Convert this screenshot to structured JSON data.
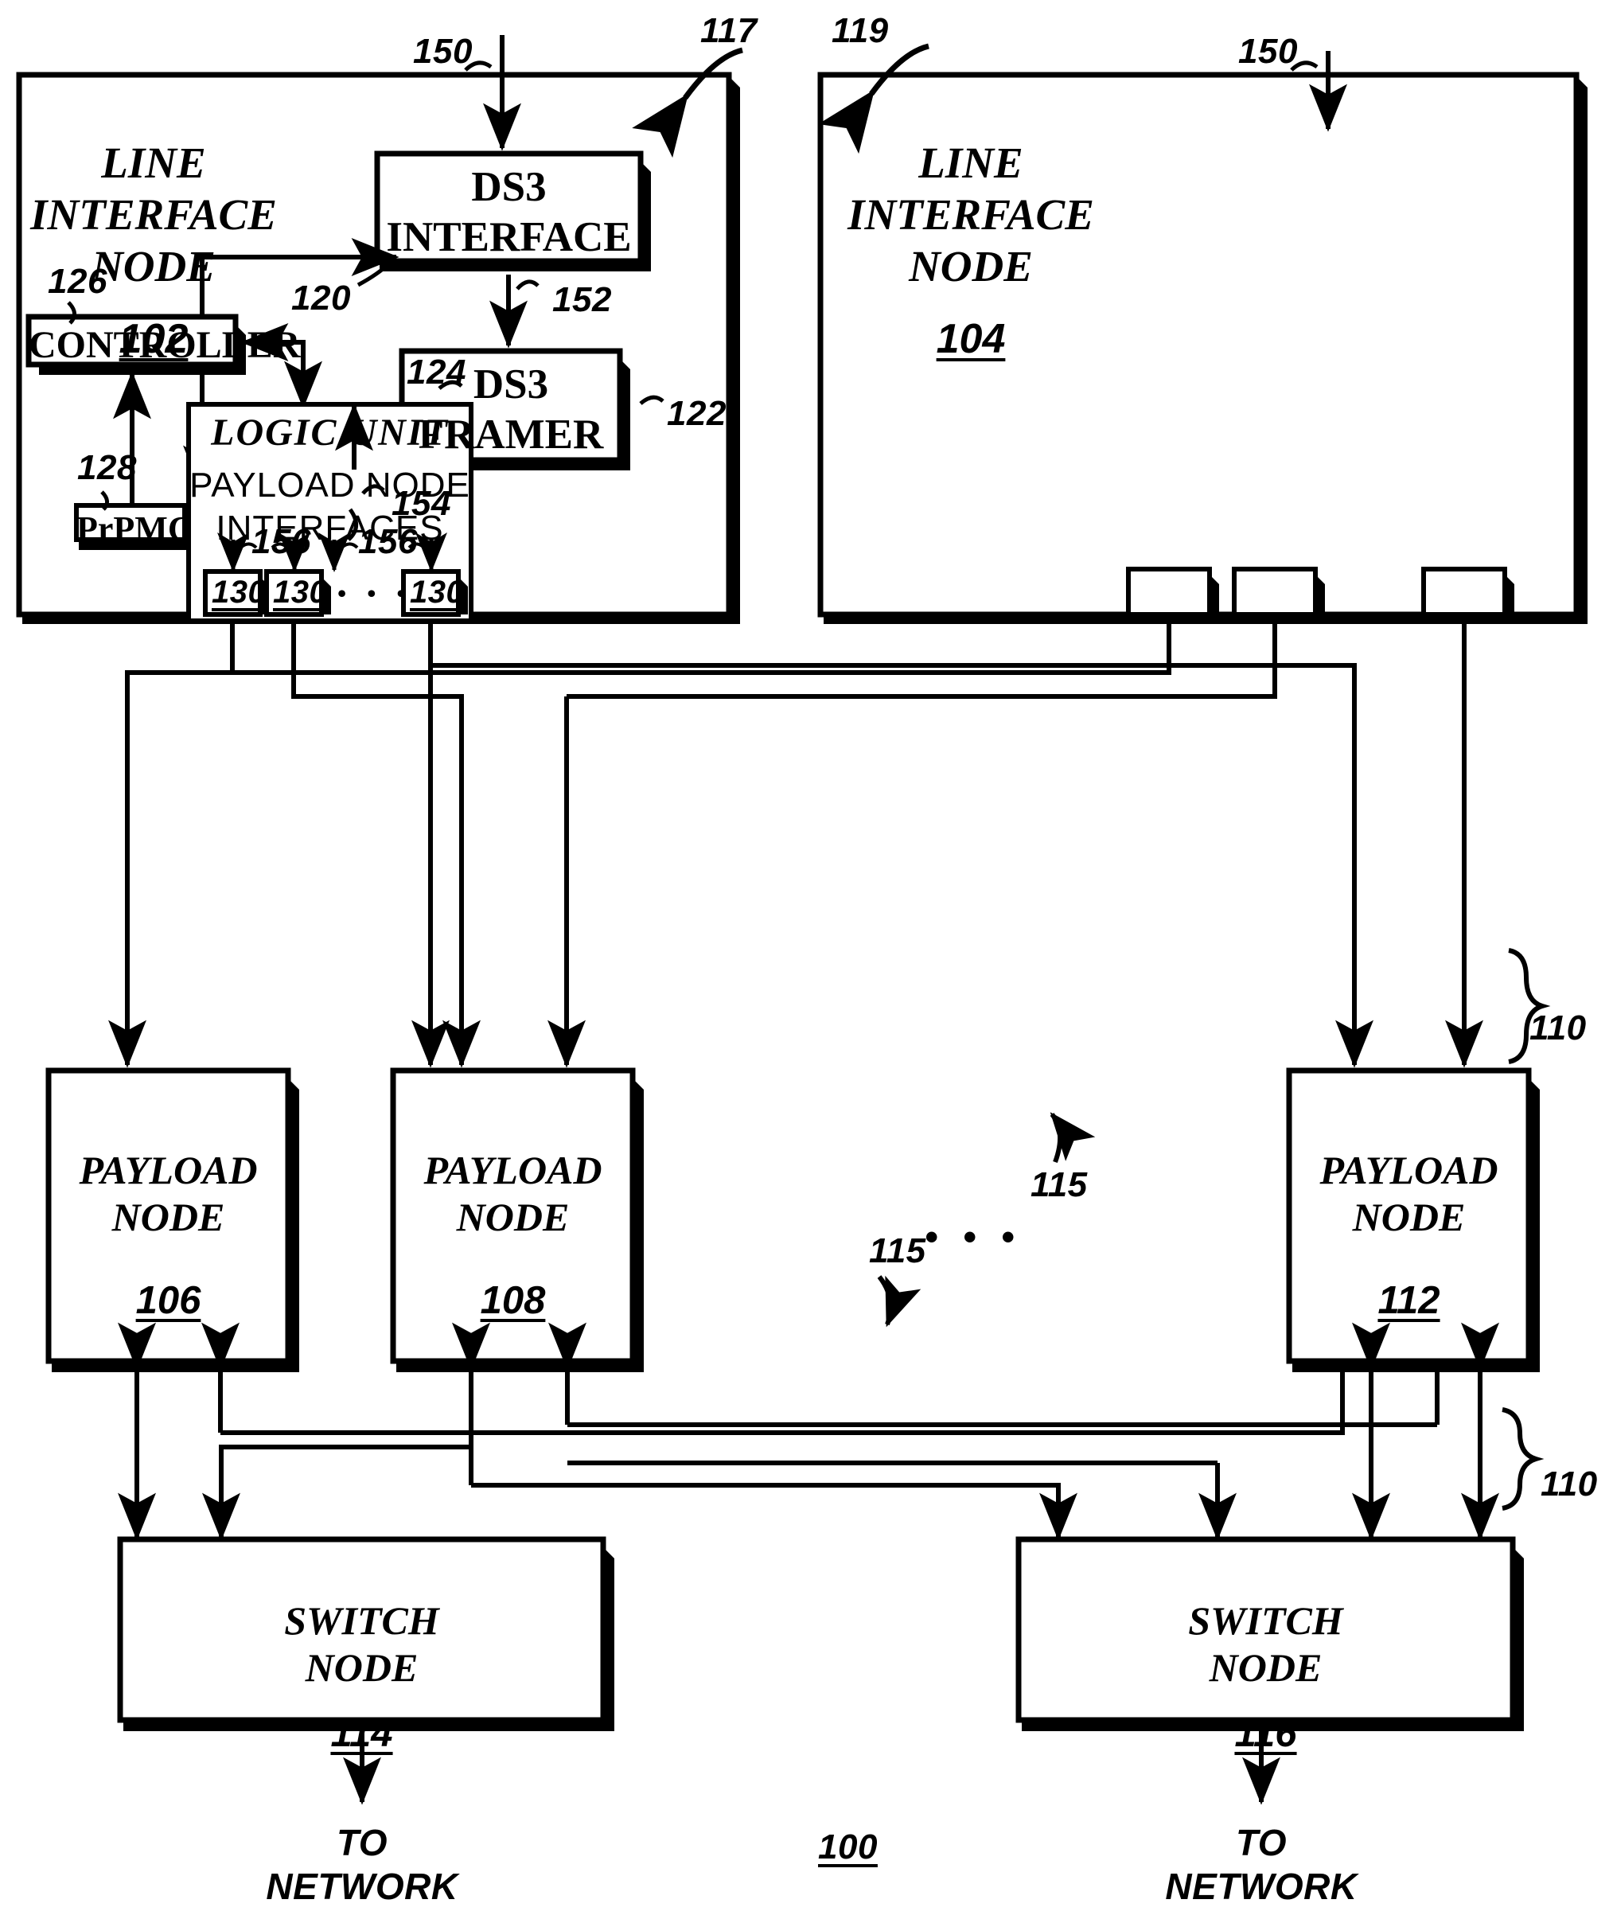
{
  "figure": {
    "number": "100",
    "title_refs": {
      "lin_group_117": "117",
      "lin_group_119": "119"
    }
  },
  "line_interface_nodes": [
    {
      "name": "LINE\nINTERFACE\nNODE",
      "ref": "102",
      "group_ref": "117",
      "input_signal_ref": "150",
      "blocks": [
        {
          "name": "DS3\nINTERFACE",
          "ref": "120"
        },
        {
          "name": "DS3\nFRAMER",
          "ref": "122"
        },
        {
          "name": "CONTROLLER",
          "ref": "126"
        },
        {
          "name": "PrPMC",
          "ref": "128"
        },
        {
          "name": "LOGIC UNIT",
          "ref": "124",
          "sub_label": "PAYLOAD NODE\nINTERFACES"
        }
      ],
      "signal_refs": {
        "ds3_interface_to_framer": "152",
        "framer_to_logic": "154",
        "interface_to_port": "156"
      },
      "ports": [
        {
          "ref": "130"
        },
        {
          "ref": "130"
        },
        {
          "ref": "130"
        }
      ],
      "port_ellipsis": "• • •"
    },
    {
      "name": "LINE\nINTERFACE\nNODE",
      "ref": "104",
      "group_ref": "119",
      "input_signal_ref": "150",
      "blocks": [],
      "ports": [
        {},
        {},
        {}
      ]
    }
  ],
  "payload_nodes": [
    {
      "name": "PAYLOAD\nNODE",
      "ref": "106"
    },
    {
      "name": "PAYLOAD\nNODE",
      "ref": "108"
    },
    {
      "name": "PAYLOAD\nNODE",
      "ref": "112"
    }
  ],
  "payload_ellipsis": "• • •",
  "switch_nodes": [
    {
      "name": "SWITCH\nNODE",
      "ref": "114",
      "output_label": "TO\nNETWORK"
    },
    {
      "name": "SWITCH\nNODE",
      "ref": "116",
      "output_label": "TO\nNETWORK"
    }
  ],
  "link_refs": {
    "bus_upper": "110",
    "bus_lower": "110",
    "link_upper": "115",
    "link_lower": "115"
  },
  "colors": {
    "stroke": "#000000",
    "background": "#ffffff"
  }
}
